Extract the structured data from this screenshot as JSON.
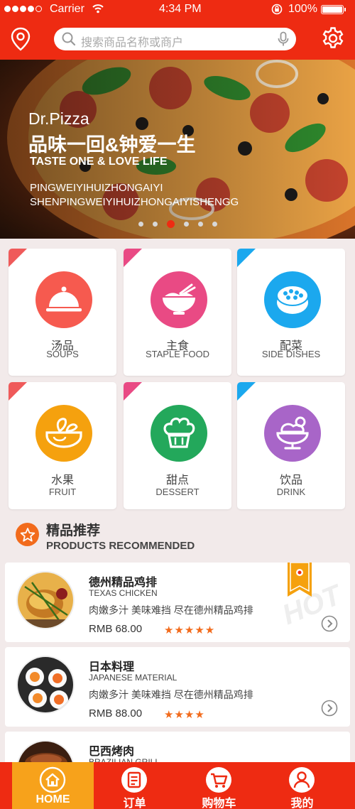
{
  "status_bar": {
    "carrier": "Carrier",
    "time": "4:34 PM",
    "battery": "100%"
  },
  "search": {
    "placeholder": "搜索商品名称或商户"
  },
  "banner": {
    "brand": "Dr.Pizza",
    "slogan_zh": "品味一回&钟爱一生",
    "slogan_en": "TASTE ONE & LOVE LIFE",
    "line1": "PINGWEIYIHUIZHONGAIYI",
    "line2": "SHENPINGWEIYIHUIZHONGAIYISHENGG",
    "slide_count": 6,
    "active_slide": 3
  },
  "categories": [
    {
      "zh": "汤品",
      "en": "SOUPS",
      "color": "#f65a4f",
      "corner": "#ef5a5a",
      "icon": "cloche-icon"
    },
    {
      "zh": "主食",
      "en": "STAPLE FOOD",
      "color": "#e94a84",
      "corner": "#e94a84",
      "icon": "rice-bowl-icon"
    },
    {
      "zh": "配菜",
      "en": "SIDE DISHES",
      "color": "#1ba8ee",
      "corner": "#1ba8ee",
      "icon": "sushi-icon"
    },
    {
      "zh": "水果",
      "en": "FRUIT",
      "color": "#f5a10e",
      "corner": "#ef5a5a",
      "icon": "fruit-bowl-icon"
    },
    {
      "zh": "甜点",
      "en": "DESSERT",
      "color": "#23a85b",
      "corner": "#e94a84",
      "icon": "cake-icon"
    },
    {
      "zh": "饮品",
      "en": "DRINK",
      "color": "#a865c8",
      "corner": "#1ba8ee",
      "icon": "sundae-icon"
    }
  ],
  "recommend": {
    "title_zh": "精品推荐",
    "title_en": "PRODUCTS RECOMMENDED"
  },
  "products": [
    {
      "name": "德州精品鸡排",
      "sub": "TEXAS CHICKEN",
      "desc": "肉嫩多汁 美味难挡 尽在德州精品鸡排",
      "price": "RMB 68.00",
      "stars": "★★★★★",
      "badge": "HOT"
    },
    {
      "name": "日本料理",
      "sub": "JAPANESE MATERIAL",
      "desc": "肉嫩多汁 美味难挡 尽在德州精品鸡排",
      "price": "RMB 88.00",
      "stars": "★★★★"
    },
    {
      "name": "巴西烤肉",
      "sub": "BRAZILIAN GRILL"
    }
  ],
  "tabs": [
    {
      "label": "HOME",
      "icon": "home-icon",
      "active": true
    },
    {
      "label": "订单",
      "icon": "order-icon"
    },
    {
      "label": "购物车",
      "icon": "cart-icon"
    },
    {
      "label": "我的",
      "icon": "user-icon"
    }
  ],
  "colors": {
    "primary": "#ee2b12",
    "accent": "#f7a21b",
    "star": "#f26b1c"
  }
}
